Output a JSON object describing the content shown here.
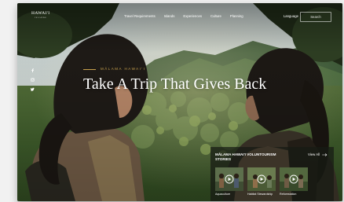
{
  "brand": {
    "name": "HAWAI'I",
    "tagline": "ISLANDS"
  },
  "nav": {
    "links": [
      "Travel Requirements",
      "Islands",
      "Experiences",
      "Culture",
      "Planning"
    ],
    "language_label": "Language",
    "search_label": "Search"
  },
  "hero": {
    "eyebrow": "MĀLAMA HAWAI'I",
    "title": "Take A Trip That Gives Back"
  },
  "social": {
    "icons": [
      "facebook-icon",
      "instagram-icon",
      "twitter-icon"
    ]
  },
  "stories": {
    "title": "MĀLAMA HAWAI'I VOLUNTOURISM STORIES",
    "view_all_label": "View All",
    "cards": [
      {
        "label": "Aquaculture"
      },
      {
        "label": "Habitat Stewardship"
      },
      {
        "label": "Reforestation"
      }
    ]
  },
  "colors": {
    "accent_gold": "#c9a24e",
    "nav_text": "#ffffff",
    "panel_bg": "#161a14"
  }
}
